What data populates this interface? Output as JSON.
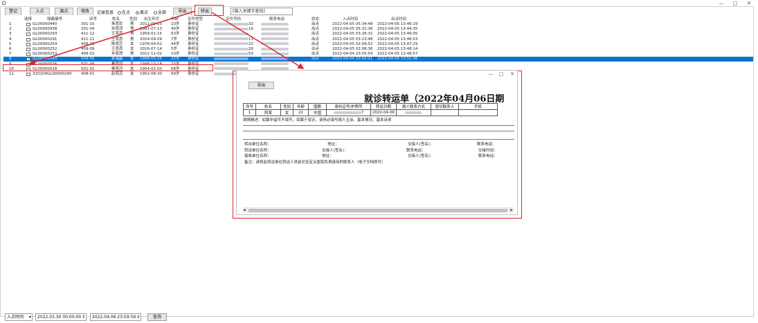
{
  "window": {
    "minimize": "—",
    "maximize": "□",
    "close": "✕"
  },
  "toolbar": {
    "buttons": [
      "登记",
      "入点",
      "离点",
      "修改",
      "记录信息"
    ],
    "radios": [
      {
        "label": "在点",
        "checked": false
      },
      {
        "label": "离点",
        "checked": true
      },
      {
        "label": "全部",
        "checked": false
      }
    ],
    "export_label": "导出",
    "transfer_label": "转出",
    "search_placeholder": "[输入关键字查找]"
  },
  "table": {
    "headers": [
      "选择",
      "隔离编号",
      "床号",
      "姓名",
      "性别",
      "出生年月",
      "年龄",
      "证件类型",
      "证件号码",
      "联系电话",
      "状态",
      "入点时间",
      "出点时间"
    ],
    "rows": [
      {
        "no": "1",
        "checked": false,
        "id": "GL00000440",
        "room": "301-10",
        "name": "朱某彭",
        "sex": "男",
        "birth": "2011-09-15",
        "age": "10岁",
        "idtype": "身份证",
        "idtail": "32",
        "phonetail": "",
        "status": "出点",
        "in": "2022-04-05 05:34:48",
        "out": "2022-04-05 13:46:19",
        "selected": false
      },
      {
        "no": "2",
        "checked": false,
        "id": "GL00000438",
        "room": "301-09",
        "name": "孙某清",
        "sex": "男",
        "birth": "1981-07-13",
        "age": "40岁",
        "idtype": "身份证",
        "idtail": "16",
        "phonetail": "",
        "status": "出点",
        "in": "2022-04-05 05:31:36",
        "out": "2022-04-05 13:44:35",
        "selected": false
      },
      {
        "no": "3",
        "checked": false,
        "id": "GL00000293",
        "room": "411-12",
        "name": "王某燕",
        "sex": "男",
        "birth": "1959-01-15",
        "age": "63岁",
        "idtype": "身份证",
        "idtail": "",
        "phonetail": "",
        "status": "出点",
        "in": "2022-04-05 03:26:32",
        "out": "2022-04-05 13:46:05",
        "selected": false
      },
      {
        "no": "4",
        "checked": false,
        "id": "GL00000291",
        "room": "411-11",
        "name": "王某豪",
        "sex": "男",
        "birth": "2014-09-09",
        "age": "7岁",
        "idtype": "身份证",
        "idtail": "13",
        "phonetail": "",
        "status": "出点",
        "in": "2022-04-05 03:23:48",
        "out": "2022-04-05 13:46:53",
        "selected": false
      },
      {
        "no": "5",
        "checked": false,
        "id": "GL00000254",
        "room": "409-10",
        "name": "陈某芝",
        "sex": "女",
        "birth": "1978-04-02",
        "age": "44岁",
        "idtype": "身份证",
        "idtail": "22",
        "phonetail": "",
        "status": "出点",
        "in": "2022-04-05 02:09:52",
        "out": "2022-04-05 13:47:29",
        "selected": false
      },
      {
        "no": "6",
        "checked": false,
        "id": "GL00000252",
        "room": "409-09",
        "name": "王某鑫",
        "sex": "女",
        "birth": "2016-07-14",
        "age": "5岁",
        "idtype": "身份证",
        "idtail": "26",
        "phonetail": "",
        "status": "出点",
        "in": "2022-04-05 02:08:36",
        "out": "2022-04-05 13:48:14",
        "selected": false
      },
      {
        "no": "7",
        "checked": false,
        "id": "GL00000253",
        "room": "408-02",
        "name": "孙某琪",
        "sex": "男",
        "birth": "2011-11-02",
        "age": "10岁",
        "idtype": "身份证",
        "idtail": "53",
        "phonetail": "",
        "status": "出点",
        "in": "2022-04-04 23:55:54",
        "out": "2022-04-05 13:48:57",
        "selected": false
      },
      {
        "no": "8",
        "checked": true,
        "id": "GL00000083",
        "room": "504-05",
        "name": "某某某",
        "sex": "女",
        "birth": "1999-05-26",
        "age": "22岁",
        "idtype": "身份证",
        "idtail": "",
        "phonetail": "",
        "status": "出点",
        "in": "2022-04-04 20:02:21",
        "out": "2022-04-05 13:51:36",
        "selected": true
      },
      {
        "no": "9",
        "checked": false,
        "id": "GL00000036",
        "room": "501-06",
        "name": "秦某丽",
        "sex": "女",
        "birth": "1998-10-18",
        "age": "23岁",
        "idtype": "身份证",
        "idtail": "",
        "phonetail": "",
        "status": "",
        "in": "",
        "out": "",
        "selected": false
      },
      {
        "no": "10",
        "checked": false,
        "id": "GL00000018",
        "room": "501-01",
        "name": "杨某河",
        "sex": "女",
        "birth": "1954-01-03",
        "age": "68岁",
        "idtype": "身份证",
        "idtail": "",
        "phonetail": "",
        "status": "",
        "in": "",
        "out": "",
        "selected": false
      },
      {
        "no": "11",
        "checked": false,
        "id": "310109GL00000290",
        "room": "408-01",
        "name": "赵某英",
        "sex": "女",
        "birth": "1952-08-30",
        "age": "69岁",
        "idtype": "身份证",
        "idtail": "",
        "phonetail": "",
        "status": "",
        "in": "",
        "out": "",
        "selected": false
      }
    ]
  },
  "bottom": {
    "filter_select": "入点时间",
    "from": "2022.03.30 00:00:00",
    "to": "2022.04.06 23:59:59",
    "query_label": "查询"
  },
  "popup": {
    "export_label": "导出",
    "doc_title": "就诊转运单（2022年04月06日期",
    "table_headers": [
      "序号",
      "姓名",
      "性别",
      "年龄",
      "国籍",
      "身份证号/护照号",
      "转运日期",
      "病人联系方式",
      "密切联系人",
      "手机"
    ],
    "table_row": [
      "1",
      "阿某",
      "女",
      "22",
      "中国",
      "",
      "7",
      "2022-04-06",
      "",
      "",
      ""
    ],
    "condition_line": "病情概述：如属非留可不填写，如属于就诊，请务必填写病人主诉、基本情况、基本诉求",
    "lines": [
      [
        "转出单位名称：",
        "地址：",
        "交接人(签名)：",
        "联系电话："
      ],
      [
        "转运单位名称：",
        "交接人(签名)：",
        "联系电话：",
        "交接时间："
      ],
      [
        "接收单位名称：",
        "地址：",
        "交接人(签名)：",
        "联系电话："
      ]
    ],
    "note": "备注：请将此转运单在转运人员前交至定点医院负责接待的联系人（电子文档即可）"
  },
  "colors": {
    "selection": "#0a74d0",
    "annotation": "#e0222b"
  }
}
